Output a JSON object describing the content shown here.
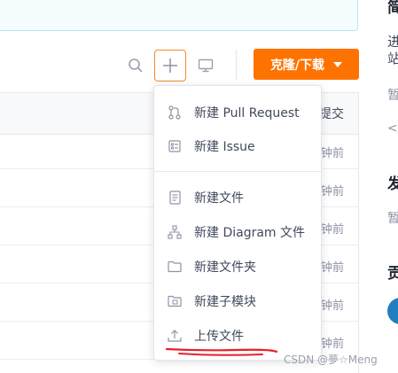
{
  "toolbar": {
    "clone_label": "克隆/下载"
  },
  "file_list": {
    "header_right": "提交",
    "times": [
      "钟前",
      "钟前",
      "钟前",
      "钟前",
      "钟前",
      "钟前"
    ]
  },
  "sidebar": {
    "frag1": "简",
    "frag2": "进",
    "frag3": "站",
    "frag4": "暂",
    "frag5": "</",
    "frag6": "发",
    "frag7": "暂",
    "frag8": "贡"
  },
  "new_menu": {
    "items": [
      {
        "label": "新建 Pull Request",
        "icon": "pull-request-icon"
      },
      {
        "label": "新建 Issue",
        "icon": "issue-icon"
      },
      {
        "label": "新建文件",
        "icon": "file-icon"
      },
      {
        "label": "新建 Diagram 文件",
        "icon": "diagram-icon"
      },
      {
        "label": "新建文件夹",
        "icon": "folder-icon"
      },
      {
        "label": "新建子模块",
        "icon": "submodule-icon"
      },
      {
        "label": "上传文件",
        "icon": "upload-icon"
      }
    ]
  },
  "watermark": "CSDN @夢☆Meng",
  "colors": {
    "accent": "#fe7300",
    "annotation": "#e8202a"
  }
}
